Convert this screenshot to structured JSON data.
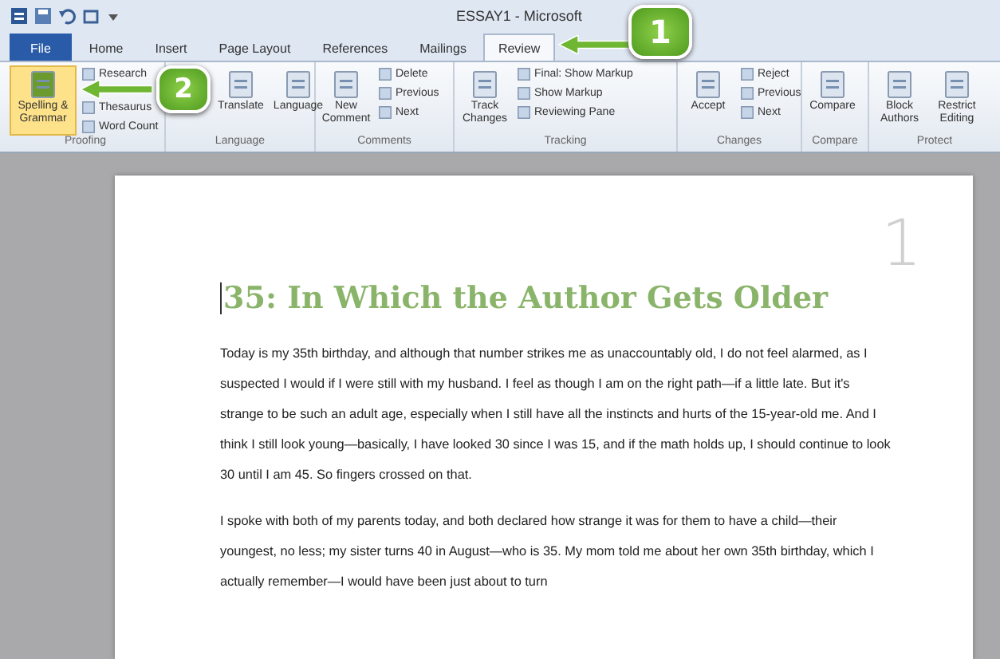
{
  "window": {
    "title": "ESSAY1 - Microsoft"
  },
  "tabs": [
    {
      "label": "File",
      "kind": "file",
      "selected": false
    },
    {
      "label": "Home",
      "kind": "tab",
      "selected": false
    },
    {
      "label": "Insert",
      "kind": "tab",
      "selected": false
    },
    {
      "label": "Page Layout",
      "kind": "tab",
      "selected": false
    },
    {
      "label": "References",
      "kind": "tab",
      "selected": false
    },
    {
      "label": "Mailings",
      "kind": "tab",
      "selected": false
    },
    {
      "label": "Review",
      "kind": "tab",
      "selected": true
    }
  ],
  "ribbon": {
    "groups": [
      {
        "label": "Proofing",
        "items": [
          {
            "label": "Spelling & Grammar",
            "kind": "large",
            "selected": true
          },
          {
            "label": "Research",
            "kind": "small",
            "selected": false
          },
          {
            "label": "Thesaurus",
            "kind": "small",
            "selected": false
          },
          {
            "label": "Word Count",
            "kind": "small",
            "selected": false
          }
        ]
      },
      {
        "label": "Language",
        "items": [
          {
            "label": "Translate",
            "kind": "large",
            "selected": false
          },
          {
            "label": "Language",
            "kind": "large",
            "selected": false
          }
        ]
      },
      {
        "label": "Comments",
        "items": [
          {
            "label": "New Comment",
            "kind": "large",
            "selected": false
          },
          {
            "label": "Delete",
            "kind": "small",
            "selected": false
          },
          {
            "label": "Previous",
            "kind": "small",
            "selected": false
          },
          {
            "label": "Next",
            "kind": "small",
            "selected": false
          }
        ]
      },
      {
        "label": "Tracking",
        "items": [
          {
            "label": "Track Changes",
            "kind": "large",
            "selected": false
          },
          {
            "label": "Final: Show Markup",
            "kind": "small",
            "selected": false
          },
          {
            "label": "Show Markup",
            "kind": "small",
            "selected": false
          },
          {
            "label": "Reviewing Pane",
            "kind": "small",
            "selected": false
          }
        ]
      },
      {
        "label": "Changes",
        "items": [
          {
            "label": "Accept",
            "kind": "large",
            "selected": false
          },
          {
            "label": "Reject",
            "kind": "small",
            "selected": false
          },
          {
            "label": "Previous",
            "kind": "small",
            "selected": false
          },
          {
            "label": "Next",
            "kind": "small",
            "selected": false
          }
        ]
      },
      {
        "label": "Compare",
        "items": [
          {
            "label": "Compare",
            "kind": "large",
            "selected": false
          }
        ]
      },
      {
        "label": "Protect",
        "items": [
          {
            "label": "Block Authors",
            "kind": "large",
            "selected": false
          },
          {
            "label": "Restrict Editing",
            "kind": "large",
            "selected": false
          }
        ]
      }
    ]
  },
  "document": {
    "page_number": "1",
    "heading": "35: In Which the Author Gets Older",
    "paragraphs": [
      "Today is my 35th birthday, and although that number strikes me as unaccountably old, I do not feel alarmed, as I suspected I would if I were still with my husband. I feel as though I am on the right path—if a little late. But it's strange to be such an adult age, especially when I still have all the instincts and hurts of the 15-year-old me. And I think I still look young—basically, I have looked 30 since I was 15, and if the math holds up, I should continue to look 30 until I am 45. So fingers crossed on that.",
      "I spoke with both of my parents today, and both declared how strange it was for them to have a child—their youngest, no less; my sister turns 40 in August—who is 35. My mom told me about her own 35th birthday, which I actually remember—I would have been just about to turn"
    ]
  },
  "callouts": [
    {
      "number": "1"
    },
    {
      "number": "2"
    }
  ]
}
